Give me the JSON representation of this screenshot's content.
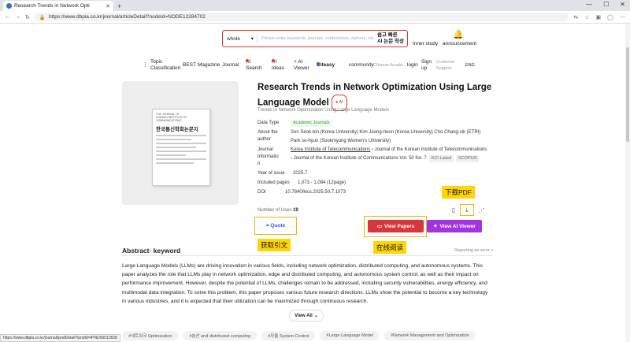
{
  "browser": {
    "tab_title": "Research Trends in Network Opti",
    "tab_close": "✕",
    "new_tab": "+",
    "window_controls": [
      "—",
      "☐",
      "✕"
    ],
    "url": "https://www.dbpia.co.kr/journal/articleDetail?nodeId=NODE12284702",
    "status_url": "https://www.dbpia.co.kr/journal/ipndDetail?ipndId=IPND00010528"
  },
  "header": {
    "search_scope": "whole",
    "search_placeholder": "Please enter keywords, journals, conferences, authors, etc.",
    "ai_label_line1": "쉽고 빠른",
    "ai_label_line2": "AI 논문 작성",
    "inner_study": "Inner study",
    "announcement": "announcement"
  },
  "nav": {
    "topic_line1": "Topic",
    "topic_line2": "Classification",
    "best": "BEST",
    "magazine": "Magazine",
    "journal": "Journal",
    "ai_search_line1": "AI",
    "ai_search_line2": "Search",
    "ai_ideas_line1": "AI",
    "ai_ideas_line2": "Ideas",
    "ai_viewer_line1": "AI",
    "ai_viewer_line2": "Viewer",
    "citeasy": "Citeasy",
    "community": "community",
    "chinese": "Chinese Acade...",
    "login": "login",
    "signup_line1": "Sign",
    "signup_line2": "up",
    "support_line1": "Customer",
    "support_line2": "Support",
    "lang": "ENG"
  },
  "cover": {
    "journal_name_top": "THE JOURNAL OF",
    "journal_name_mid": "KOREAN INSTITUTE OF COMMUNICATIONS",
    "journal_title": "한국통신학회논문지"
  },
  "article": {
    "title": "Research Trends in Network Optimization Using Large Language Model",
    "ai_badge": "● AI",
    "subtitle": "Trends in Network Optimization Using Large Language Models",
    "data_type_label": "Data Type",
    "data_type": "Academic Journals",
    "author_label_line1": "About the",
    "author_label_line2": "author",
    "authors_line1": "Son Seok-bin (Korea University)  Kim Joong-heon (Korea University)  Cho Chang-sik (ETRI)",
    "authors_line2": "Park so-hyun (Sookmyung Women's University)",
    "journal_label_line1": "Journal",
    "journal_label_line2": "Informatio",
    "journal_label_line3": "n",
    "journal_publisher": "Korea Institute of Telecommunications",
    "journal_name": "Journal of the Korean Institute of Telecommunications",
    "journal_issue": "Journal of the Korean Institute of Communications Vol. 50 No. 7",
    "tag_kci": "KCI Listed",
    "tag_scopus": "SCOPUS",
    "year_label": "Year of issue",
    "year": "2025.7",
    "pages_label": "Included pages",
    "pages": "1,073 - 1,084 (12page)",
    "doi_label": "DOI",
    "doi": "10.7840/kics.2025.50.7.1073",
    "uses_label": "Number of Uses",
    "uses": "19"
  },
  "actions": {
    "quote": "Quote",
    "view_papers": "View Papers",
    "view_ai": "View AI Viewer",
    "download_label": "下载PDF",
    "quote_label": "获取引文",
    "read_label": "在线阅读"
  },
  "abstract": {
    "heading": "Abstract· keyword",
    "report": "Reporting an error  >",
    "text": "Large Language Models (LLMs) are driving innovation in various fields, including network optimization, distributed computing, and autonomous systems. This paper analyzes the role that LLMs play in network optimization, edge and distributed computing, and autonomous system control, as well as their impact on performance improvement. However, despite the potential of LLMs, challenges remain to be addressed, including security vulnerabilities, energy efficiency, and multimodal data integration. To solve this problem, this paper proposes various future research directions. LLMs show the potential to become a key technology in various industries, and it is expected that their utilization can be maximized through continuous research.",
    "view_all": "View All"
  },
  "keywords": [
    "#네트워크 Optimization",
    "#분산 and distributed computing",
    "#자율 System Control",
    "#Large Language Model",
    "#Network Management and Optimization"
  ],
  "colors": {
    "red": "#d8363c",
    "purple": "#a134e0",
    "highlight": "#ffd600",
    "link_blue": "#2b5bd7"
  }
}
